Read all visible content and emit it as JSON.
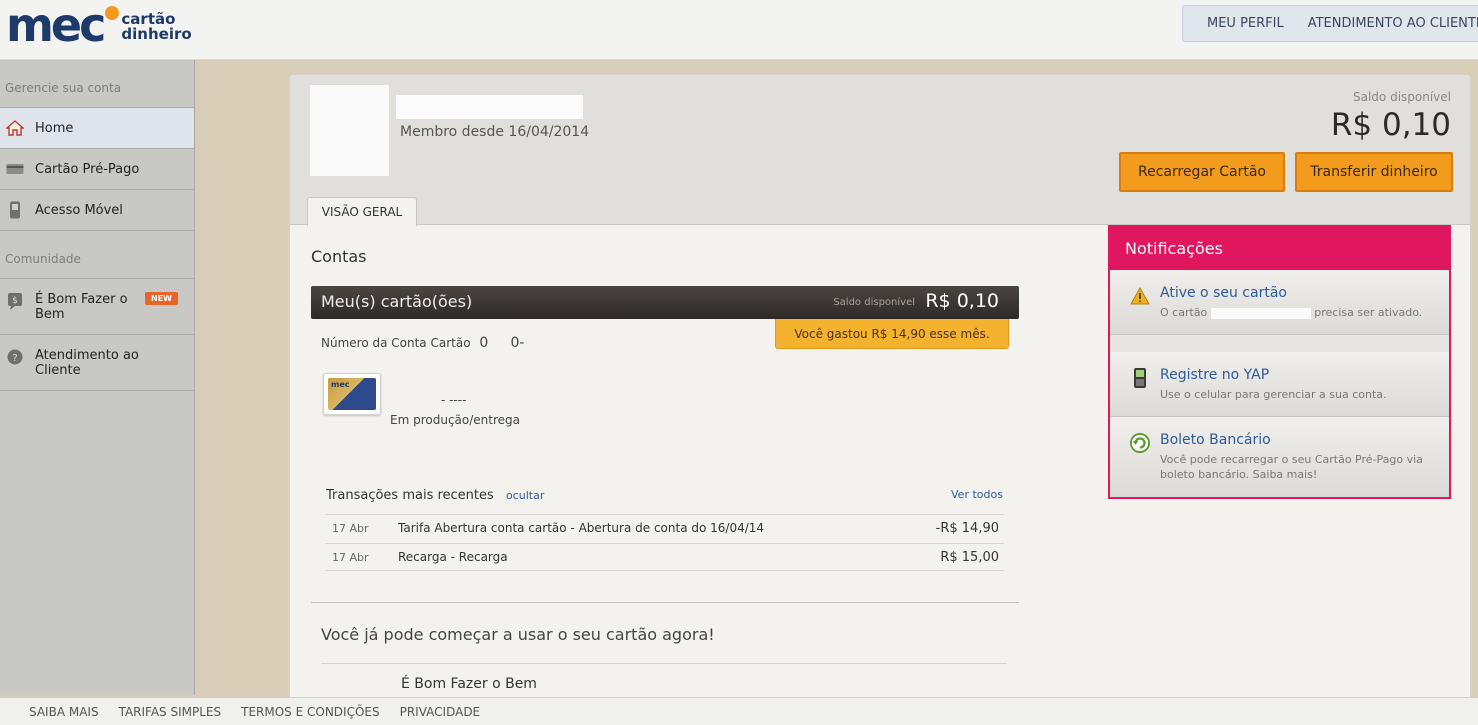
{
  "header": {
    "logo_word": "mec",
    "logo_sub": "cartão\ndinheiro",
    "nav": [
      "MEU PERFIL",
      "ATENDIMENTO AO CLIENTE"
    ]
  },
  "sidebar": {
    "section_account": "Gerencie sua conta",
    "items": [
      {
        "label": "Home",
        "icon": "home-icon"
      },
      {
        "label": "Cartão Pré-Pago",
        "icon": "card-icon"
      },
      {
        "label": "Acesso Móvel",
        "icon": "mobile-icon"
      }
    ],
    "section_community": "Comunidade",
    "community_items": [
      {
        "label": "É Bom Fazer o Bem",
        "badge": "NEW",
        "icon": "money-icon"
      },
      {
        "label": "Atendimento ao Cliente",
        "icon": "help-icon"
      }
    ]
  },
  "profile": {
    "member_since": "Membro desde 16/04/2014",
    "saldo_label": "Saldo disponível",
    "saldo_value": "R$ 0,10",
    "btn_recarregar": "Recarregar Cartão",
    "btn_transferir": "Transferir dinheiro",
    "tab": "VISÃO GERAL"
  },
  "contas": {
    "title": "Contas",
    "bar_title": "Meu(s) cartão(ões)",
    "bar_saldo_label": "Saldo disponível",
    "bar_saldo_value": "R$ 0,10",
    "spent": "Você gastou R$ 14,90 esse mês.",
    "conta_label": "Número da Conta Cartão",
    "conta_value": "0     0-",
    "card_brand": "mec",
    "card_number": "- ----",
    "card_status": "Em produção/entrega"
  },
  "transactions": {
    "title": "Transações mais recentes",
    "hide": "ocultar",
    "see_all": "Ver todos",
    "rows": [
      {
        "date": "17 Abr",
        "desc": "Tarifa Abertura conta cartão - Abertura de conta do 16/04/14",
        "amount": "-R$ 14,90"
      },
      {
        "date": "17 Abr",
        "desc": "Recarga - Recarga",
        "amount": "R$ 15,00"
      }
    ]
  },
  "start": {
    "text": "Você já pode começar a usar o seu cartão agora!",
    "item": "É Bom Fazer o Bem"
  },
  "notifications": {
    "title": "Notificações",
    "items": [
      {
        "title": "Ative o seu cartão",
        "text_before": "O cartão",
        "text_after": "precisa ser ativado.",
        "icon": "warning-icon"
      },
      {
        "title": "Registre no YAP",
        "text": "Use o celular para gerenciar a sua conta.",
        "icon": "phone-icon"
      },
      {
        "title": "Boleto Bancário",
        "text": "Você pode recarregar o seu Cartão Pré-Pago via boleto bancário. Saiba mais!",
        "icon": "refresh-icon"
      }
    ]
  },
  "footer": [
    "SAIBA MAIS",
    "TARIFAS SIMPLES",
    "TERMOS E CONDIÇÕES",
    "PRIVACIDADE"
  ],
  "colors": {
    "brand_blue": "#1e3a6b",
    "brand_orange": "#f39a1e",
    "notif_pink": "#e0165f",
    "button_orange": "#f29b1d"
  }
}
